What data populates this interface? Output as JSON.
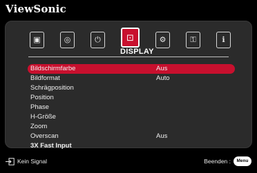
{
  "brand": "ViewSonic",
  "tabs": [
    {
      "name": "picture-tab",
      "glyph": "▣"
    },
    {
      "name": "color-tab",
      "glyph": "◎"
    },
    {
      "name": "power-tab",
      "glyph": "⏻"
    },
    {
      "name": "display-tab",
      "glyph": "⊡",
      "active": true
    },
    {
      "name": "settings-tab",
      "glyph": "⚙"
    },
    {
      "name": "advanced-tab",
      "glyph": "⚿"
    },
    {
      "name": "info-tab",
      "glyph": "ℹ"
    }
  ],
  "active_tab_label": "DISPLAY",
  "menu": [
    {
      "label": "Bildschirmfarbe",
      "value": "Aus"
    },
    {
      "label": "Bildformat",
      "value": "Auto"
    },
    {
      "label": "Schrägposition",
      "value": ""
    },
    {
      "label": "Position",
      "value": ""
    },
    {
      "label": "Phase",
      "value": ""
    },
    {
      "label": "H-Größe",
      "value": ""
    },
    {
      "label": "Zoom",
      "value": ""
    },
    {
      "label": "Overscan",
      "value": "Aus"
    },
    {
      "label": "3X Fast Input",
      "value": ""
    }
  ],
  "footer": {
    "signal": "Kein Signal",
    "exit": "Beenden :",
    "menu_button": "Menu"
  },
  "colors": {
    "accent": "#c8102e",
    "panel": "#2b2b2b"
  }
}
